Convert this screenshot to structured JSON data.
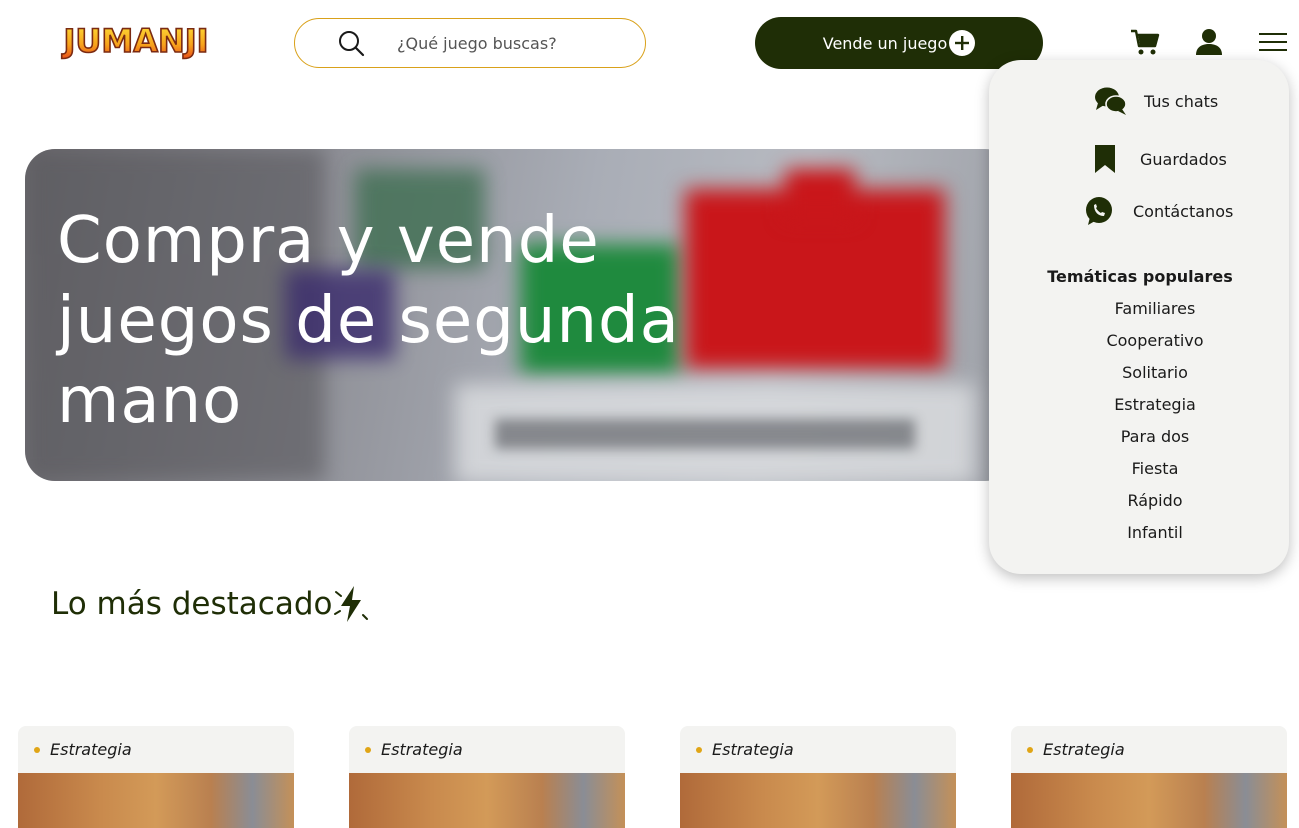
{
  "header": {
    "logo_text": "JUMANJI",
    "search_placeholder": "¿Qué juego buscas?",
    "sell_button_label": "Vende un juego"
  },
  "hero": {
    "title": "Compra y vende juegos de segunda mano"
  },
  "menu": {
    "items": [
      {
        "label": "Tus chats",
        "icon": "chats-icon"
      },
      {
        "label": "Guardados",
        "icon": "bookmark-icon"
      },
      {
        "label": "Contáctanos",
        "icon": "whatsapp-icon"
      }
    ],
    "themes_heading": "Temáticas populares",
    "themes": [
      "Familiares",
      "Cooperativo",
      "Solitario",
      "Estrategia",
      "Para dos",
      "Fiesta",
      "Rápido",
      "Infantil"
    ]
  },
  "featured": {
    "title": "Lo más destacado",
    "cards": [
      {
        "tag": "Estrategia"
      },
      {
        "tag": "Estrategia"
      },
      {
        "tag": "Estrategia"
      },
      {
        "tag": "Estrategia"
      }
    ]
  },
  "colors": {
    "brand_dark": "#1f2e06",
    "accent": "#d9a11a",
    "panel": "#f3f3f1"
  }
}
